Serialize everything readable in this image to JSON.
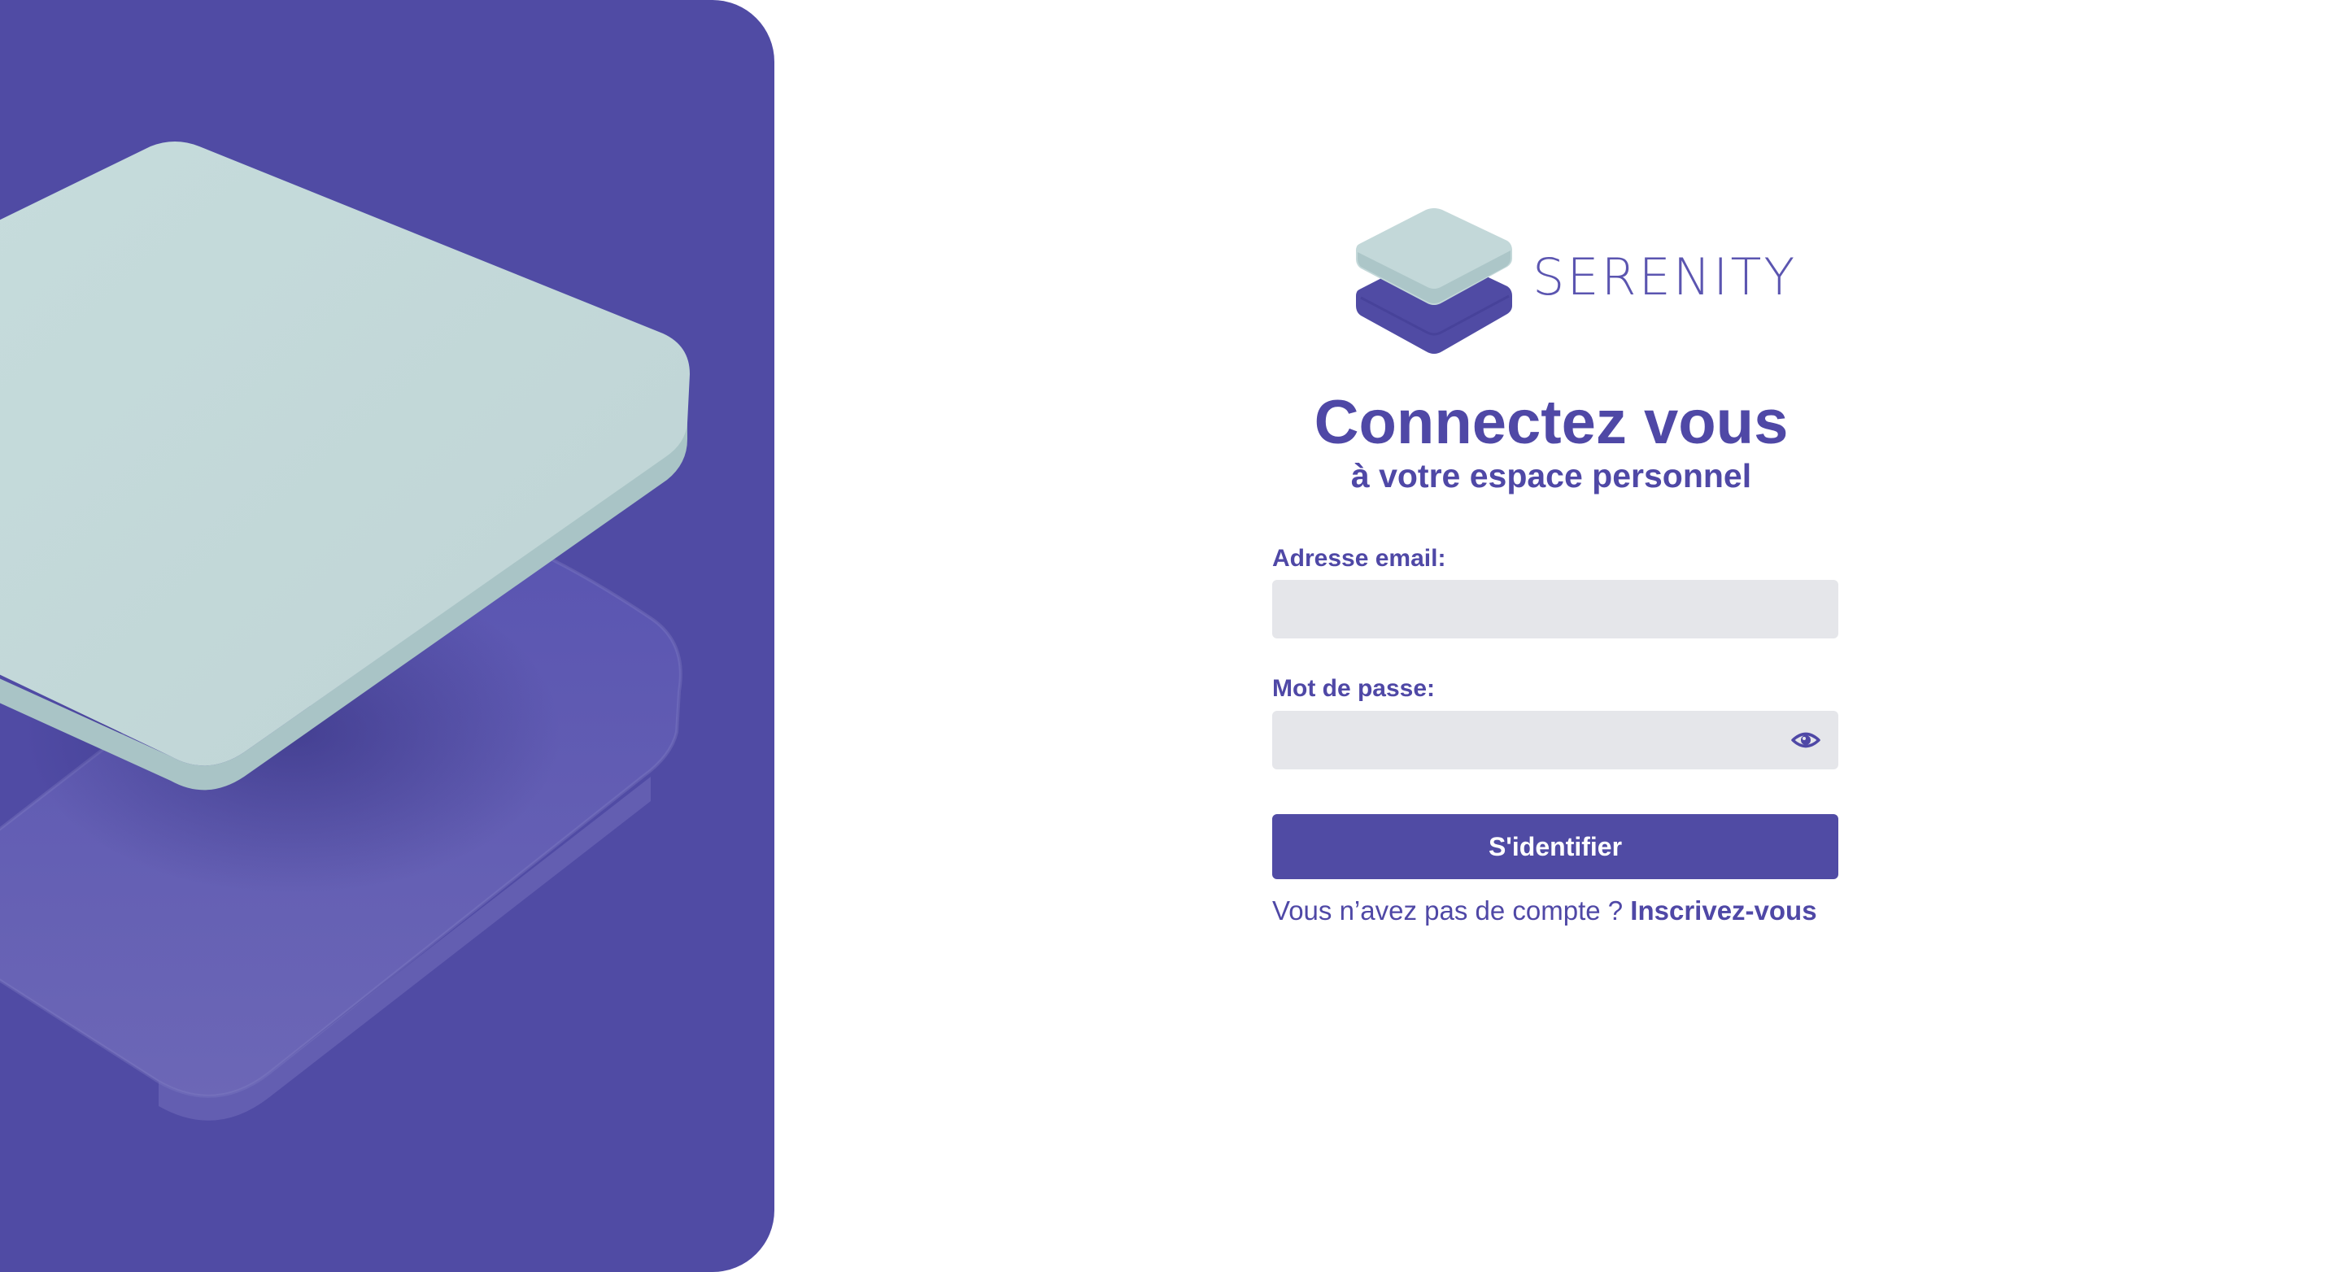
{
  "brand": {
    "name": "SERENITY",
    "primary_color": "#504ba4",
    "accent_color": "#c3d8d9"
  },
  "login": {
    "title": "Connectez vous",
    "subtitle": "à votre espace personnel",
    "email_label": "Adresse email:",
    "email_value": "",
    "password_label": "Mot de passe:",
    "password_value": "",
    "submit_label": "S'identifier",
    "no_account_text": "Vous n’avez pas de compte ?",
    "signup_link": "Inscrivez-vous"
  },
  "icons": {
    "password_toggle": "eye-icon",
    "logo": "layers-logo-icon"
  }
}
